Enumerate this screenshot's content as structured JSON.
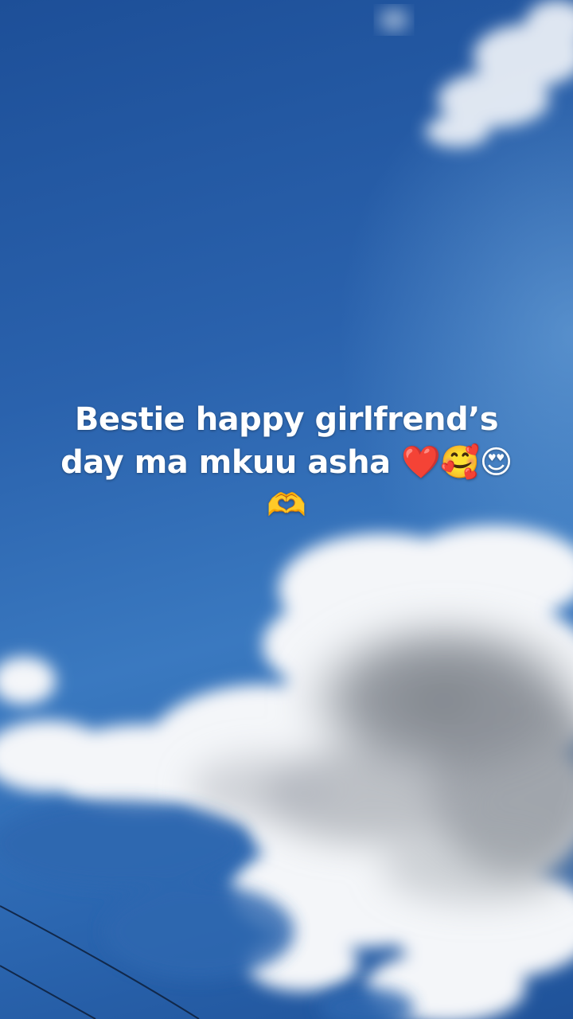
{
  "caption": {
    "line1": "Bestie happy girlfrend’s",
    "line2": "day ma mkuu asha ❤️🥰😍",
    "line3": "🫶"
  },
  "scene": {
    "sky_top_color": "#1d4f98",
    "sky_light_color": "#6aa9dc",
    "cloud_white": "#ffffff",
    "cloud_gray": "#8a8f96",
    "wire_color": "#0d1f3a"
  }
}
